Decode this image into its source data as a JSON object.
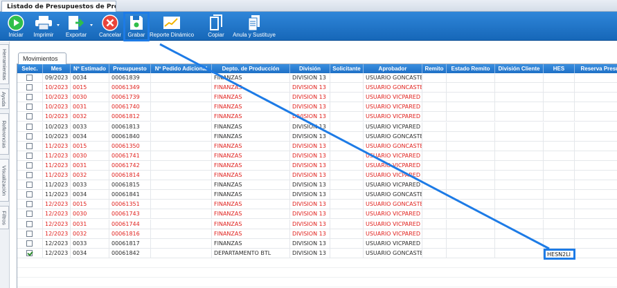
{
  "window": {
    "tab_title": "Listado de Presupuestos de Prod..."
  },
  "toolbar": {
    "buttons": [
      {
        "label": "Iniciar",
        "icon": "play-icon"
      },
      {
        "label": "Imprimir",
        "icon": "printer-icon"
      },
      {
        "label": "Exportar",
        "icon": "export-icon"
      },
      {
        "label": "Cancelar",
        "icon": "cancel-icon"
      },
      {
        "label": "Grabar",
        "icon": "save-icon"
      },
      {
        "label": "Reporte Dinámico",
        "icon": "chart-icon"
      },
      {
        "label": "Copiar",
        "icon": "copy-icon"
      },
      {
        "label": "Anula y Sustituye",
        "icon": "document-icon"
      }
    ]
  },
  "side_tabs": [
    "Herramientas",
    "Ayuda",
    "Referencias",
    "Visualización",
    "Filtros"
  ],
  "section": {
    "tab_label": "Movimientos"
  },
  "grid": {
    "columns": [
      "Selec.",
      "Mes",
      "Nº Estimado",
      "Presupuesto",
      "Nº Pedido Adicional",
      "Depto. de Producción",
      "División",
      "Solicitante",
      "Aprobador",
      "Remito",
      "Estado Remito",
      "División Cliente",
      "HES",
      "Reserva Presupu..."
    ],
    "rows": [
      {
        "checked": false,
        "color": "black",
        "mes": "09/2023",
        "estimado": "0034",
        "presupuesto": "00061839",
        "pedido": "",
        "depto": "FINANZAS",
        "division": "DIVISION 13",
        "solicitante": "",
        "aprobador": "USUARIO GONCASTE",
        "hes": ""
      },
      {
        "checked": false,
        "color": "red",
        "mes": "10/2023",
        "estimado": "0015",
        "presupuesto": "00061349",
        "pedido": "",
        "depto": "FINANZAS",
        "division": "DIVISION 13",
        "solicitante": "",
        "aprobador": "USUARIO GONCASTE",
        "hes": ""
      },
      {
        "checked": false,
        "color": "red",
        "mes": "10/2023",
        "estimado": "0030",
        "presupuesto": "00061739",
        "pedido": "",
        "depto": "FINANZAS",
        "division": "DIVISION 13",
        "solicitante": "",
        "aprobador": "USUARIO VICPARED",
        "hes": ""
      },
      {
        "checked": false,
        "color": "red",
        "mes": "10/2023",
        "estimado": "0031",
        "presupuesto": "00061740",
        "pedido": "",
        "depto": "FINANZAS",
        "division": "DIVISION 13",
        "solicitante": "",
        "aprobador": "USUARIO VICPARED",
        "hes": ""
      },
      {
        "checked": false,
        "color": "red",
        "mes": "10/2023",
        "estimado": "0032",
        "presupuesto": "00061812",
        "pedido": "",
        "depto": "FINANZAS",
        "division": "DIVISION 13",
        "solicitante": "",
        "aprobador": "USUARIO VICPARED",
        "hes": ""
      },
      {
        "checked": false,
        "color": "black",
        "mes": "10/2023",
        "estimado": "0033",
        "presupuesto": "00061813",
        "pedido": "",
        "depto": "FINANZAS",
        "division": "DIVISION 13",
        "solicitante": "",
        "aprobador": "USUARIO VICPARED",
        "hes": ""
      },
      {
        "checked": false,
        "color": "black",
        "mes": "10/2023",
        "estimado": "0034",
        "presupuesto": "00061840",
        "pedido": "",
        "depto": "FINANZAS",
        "division": "DIVISION 13",
        "solicitante": "",
        "aprobador": "USUARIO GONCASTE",
        "hes": ""
      },
      {
        "checked": false,
        "color": "red",
        "mes": "11/2023",
        "estimado": "0015",
        "presupuesto": "00061350",
        "pedido": "",
        "depto": "FINANZAS",
        "division": "DIVISION 13",
        "solicitante": "",
        "aprobador": "USUARIO GONCASTE",
        "hes": ""
      },
      {
        "checked": false,
        "color": "red",
        "mes": "11/2023",
        "estimado": "0030",
        "presupuesto": "00061741",
        "pedido": "",
        "depto": "FINANZAS",
        "division": "DIVISION 13",
        "solicitante": "",
        "aprobador": "USUARIO VICPARED",
        "hes": ""
      },
      {
        "checked": false,
        "color": "red",
        "mes": "11/2023",
        "estimado": "0031",
        "presupuesto": "00061742",
        "pedido": "",
        "depto": "FINANZAS",
        "division": "DIVISION 13",
        "solicitante": "",
        "aprobador": "USUARIO VICPARED",
        "hes": ""
      },
      {
        "checked": false,
        "color": "red",
        "mes": "11/2023",
        "estimado": "0032",
        "presupuesto": "00061814",
        "pedido": "",
        "depto": "FINANZAS",
        "division": "DIVISION 13",
        "solicitante": "",
        "aprobador": "USUARIO VICPARED",
        "hes": ""
      },
      {
        "checked": false,
        "color": "black",
        "mes": "11/2023",
        "estimado": "0033",
        "presupuesto": "00061815",
        "pedido": "",
        "depto": "FINANZAS",
        "division": "DIVISION 13",
        "solicitante": "",
        "aprobador": "USUARIO VICPARED",
        "hes": ""
      },
      {
        "checked": false,
        "color": "black",
        "mes": "11/2023",
        "estimado": "0034",
        "presupuesto": "00061841",
        "pedido": "",
        "depto": "FINANZAS",
        "division": "DIVISION 13",
        "solicitante": "",
        "aprobador": "USUARIO GONCASTE",
        "hes": ""
      },
      {
        "checked": false,
        "color": "red",
        "mes": "12/2023",
        "estimado": "0015",
        "presupuesto": "00061351",
        "pedido": "",
        "depto": "FINANZAS",
        "division": "DIVISION 13",
        "solicitante": "",
        "aprobador": "USUARIO GONCASTE",
        "hes": ""
      },
      {
        "checked": false,
        "color": "red",
        "mes": "12/2023",
        "estimado": "0030",
        "presupuesto": "00061743",
        "pedido": "",
        "depto": "FINANZAS",
        "division": "DIVISION 13",
        "solicitante": "",
        "aprobador": "USUARIO VICPARED",
        "hes": ""
      },
      {
        "checked": false,
        "color": "red",
        "mes": "12/2023",
        "estimado": "0031",
        "presupuesto": "00061744",
        "pedido": "",
        "depto": "FINANZAS",
        "division": "DIVISION 13",
        "solicitante": "",
        "aprobador": "USUARIO VICPARED",
        "hes": ""
      },
      {
        "checked": false,
        "color": "red",
        "mes": "12/2023",
        "estimado": "0032",
        "presupuesto": "00061816",
        "pedido": "",
        "depto": "FINANZAS",
        "division": "DIVISION 13",
        "solicitante": "",
        "aprobador": "USUARIO VICPARED",
        "hes": ""
      },
      {
        "checked": false,
        "color": "black",
        "mes": "12/2023",
        "estimado": "0033",
        "presupuesto": "00061817",
        "pedido": "",
        "depto": "FINANZAS",
        "division": "DIVISION 13",
        "solicitante": "",
        "aprobador": "USUARIO VICPARED",
        "hes": ""
      },
      {
        "checked": true,
        "color": "black",
        "mes": "12/2023",
        "estimado": "0034",
        "presupuesto": "00061842",
        "pedido": "",
        "depto": "DEPARTAMENTO BTL",
        "division": "DIVISION 13",
        "solicitante": "",
        "aprobador": "USUARIO GONCASTE",
        "hes": "HESN2LI"
      }
    ]
  },
  "colors": {
    "toolbar": "#1f74c8",
    "header": "#2c82d6",
    "highlight": "#1d7be6",
    "red_text": "#e0201c"
  }
}
